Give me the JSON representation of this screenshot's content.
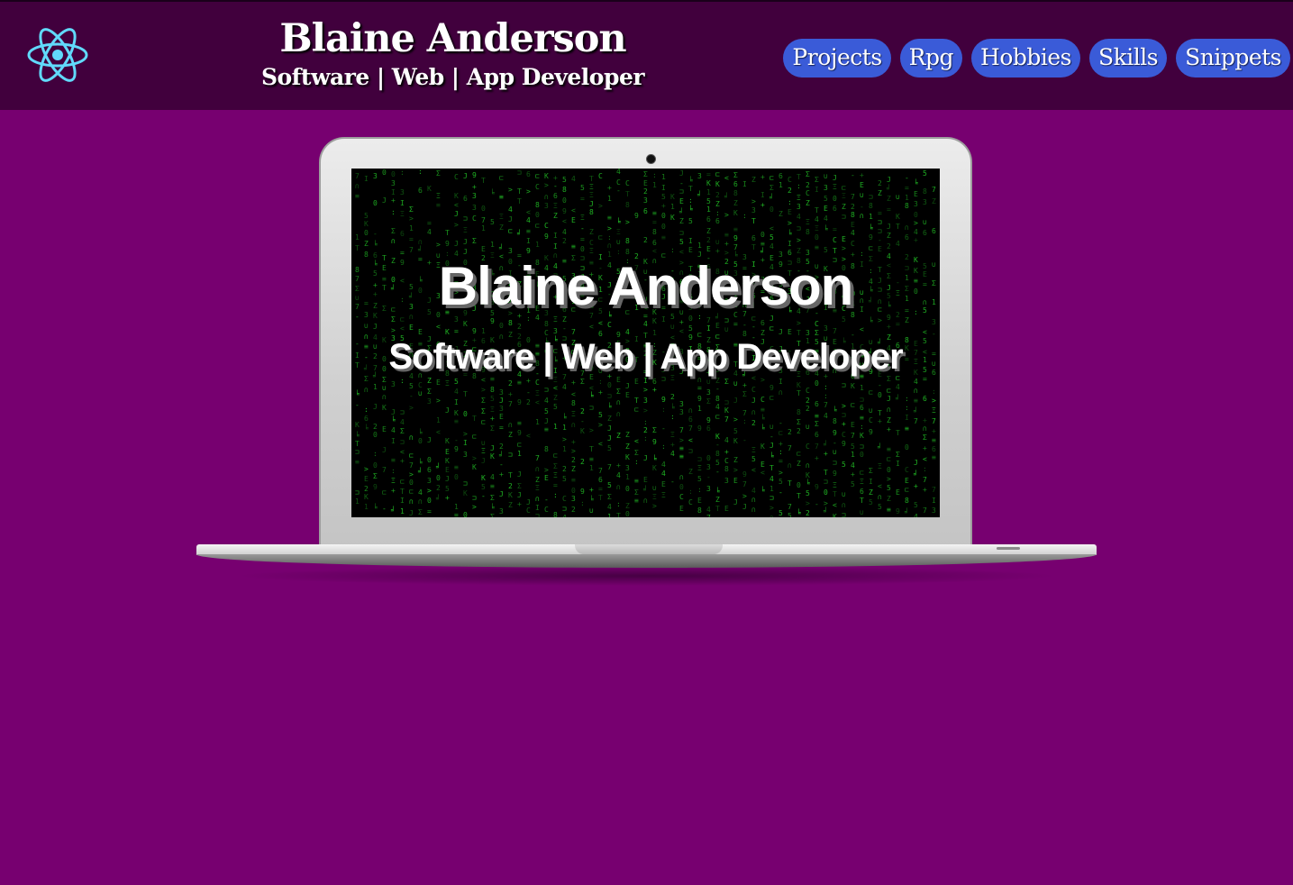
{
  "header": {
    "logo_icon": "react-atom-icon",
    "name": "Blaine Anderson",
    "tagline": "Software | Web | App Developer"
  },
  "nav": {
    "items": [
      {
        "label": "Projects"
      },
      {
        "label": "Rpg"
      },
      {
        "label": "Hobbies"
      },
      {
        "label": "Skills"
      },
      {
        "label": "Snippets"
      }
    ]
  },
  "hero": {
    "title": "Blaine Anderson",
    "subtitle": "Software | Web | App Developer"
  },
  "colors": {
    "page_background": "#770070",
    "header_background": "#41003d",
    "nav_button": "#3a5bd8",
    "logo_accent": "#61dafb",
    "matrix_green": "#22c026"
  }
}
